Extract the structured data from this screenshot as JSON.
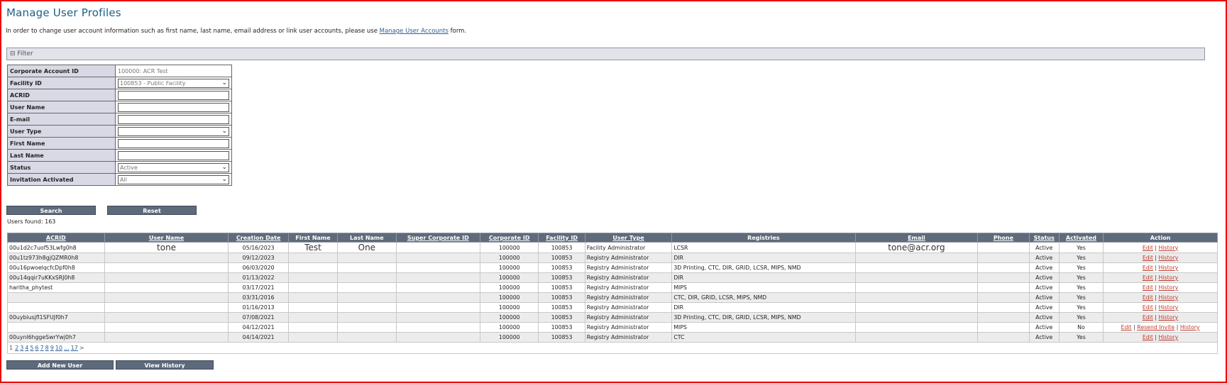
{
  "page_title": "Manage User Profiles",
  "intro": {
    "before": "In order to change user account information such as first name, last name, email address or link user accounts, please use ",
    "link": "Manage User Accounts",
    "after": " form."
  },
  "filter": {
    "toggle": "⊟",
    "label": "Filter",
    "fields": [
      {
        "label": "Corporate Account ID",
        "kind": "static",
        "value": "100000: ACR Test"
      },
      {
        "label": "Facility ID",
        "kind": "select",
        "value": "100853 - Public Facility"
      },
      {
        "label": "ACRID",
        "kind": "input",
        "value": ""
      },
      {
        "label": "User Name",
        "kind": "input",
        "value": ""
      },
      {
        "label": "E-mail",
        "kind": "input",
        "value": ""
      },
      {
        "label": "User Type",
        "kind": "select",
        "value": ""
      },
      {
        "label": "First Name",
        "kind": "input",
        "value": ""
      },
      {
        "label": "Last Name",
        "kind": "input",
        "value": ""
      },
      {
        "label": "Status",
        "kind": "select",
        "value": "Active"
      },
      {
        "label": "Invitation Activated",
        "kind": "select",
        "value": "All"
      }
    ]
  },
  "buttons": {
    "search": "Search",
    "reset": "Reset",
    "add_user": "Add New User",
    "view_history": "View History"
  },
  "users_found": "Users found: 163",
  "table": {
    "headers": [
      {
        "label": "ACRID",
        "sortable": true
      },
      {
        "label": "User Name",
        "sortable": true
      },
      {
        "label": "Creation Date",
        "sortable": true
      },
      {
        "label": "First Name",
        "sortable": false
      },
      {
        "label": "Last Name",
        "sortable": false
      },
      {
        "label": "Super Corporate ID",
        "sortable": true
      },
      {
        "label": "Corporate ID",
        "sortable": true
      },
      {
        "label": "Facility ID",
        "sortable": true
      },
      {
        "label": "User Type",
        "sortable": true
      },
      {
        "label": "Registries",
        "sortable": false
      },
      {
        "label": "Email",
        "sortable": true
      },
      {
        "label": "Phone",
        "sortable": true
      },
      {
        "label": "Status",
        "sortable": true
      },
      {
        "label": "Activated",
        "sortable": true
      },
      {
        "label": "Action",
        "sortable": false
      }
    ],
    "rows": [
      {
        "acrid": "00u1d2c7uof53Lwfg0h8",
        "username": "tone",
        "created": "05/16/2023",
        "first": "Test",
        "last": "One",
        "super": "",
        "corp": "100000",
        "facility": "100853",
        "type": "Facility Administrator",
        "registries": "LCSR",
        "email": "tone@acr.org",
        "phone": "",
        "status": "Active",
        "activated": "Yes",
        "actions": [
          "Edit",
          "History"
        ]
      },
      {
        "acrid": "00u1tz973h8gjQZMR0h8",
        "username": "",
        "created": "09/12/2023",
        "first": "",
        "last": "",
        "super": "",
        "corp": "100000",
        "facility": "100853",
        "type": "Registry Administrator",
        "registries": "DIR",
        "email": "",
        "phone": "",
        "status": "Active",
        "activated": "Yes",
        "actions": [
          "Edit",
          "History"
        ]
      },
      {
        "acrid": "00u16pwoelqcfcDpf0h8",
        "username": "",
        "created": "06/03/2020",
        "first": "",
        "last": "",
        "super": "",
        "corp": "100000",
        "facility": "100853",
        "type": "Registry Administrator",
        "registries": "3D Printing, CTC, DIR, GRID, LCSR, MIPS, NMD",
        "email": "",
        "phone": "",
        "status": "Active",
        "activated": "Yes",
        "actions": [
          "Edit",
          "History"
        ]
      },
      {
        "acrid": "00u14qqir7uKKxSRJ0h8",
        "username": "",
        "created": "01/13/2022",
        "first": "",
        "last": "",
        "super": "",
        "corp": "100000",
        "facility": "100853",
        "type": "Registry Administrator",
        "registries": "DIR",
        "email": "",
        "phone": "",
        "status": "Active",
        "activated": "Yes",
        "actions": [
          "Edit",
          "History"
        ]
      },
      {
        "acrid": "haritha_phytest",
        "username": "",
        "created": "03/17/2021",
        "first": "",
        "last": "",
        "super": "",
        "corp": "100000",
        "facility": "100853",
        "type": "Registry Administrator",
        "registries": "MIPS",
        "email": "",
        "phone": "",
        "status": "Active",
        "activated": "Yes",
        "actions": [
          "Edit",
          "History"
        ]
      },
      {
        "acrid": "",
        "username": "",
        "created": "03/31/2016",
        "first": "",
        "last": "",
        "super": "",
        "corp": "100000",
        "facility": "100853",
        "type": "Registry Administrator",
        "registries": "CTC, DIR, GRID, LCSR, MIPS, NMD",
        "email": "",
        "phone": "",
        "status": "Active",
        "activated": "Yes",
        "actions": [
          "Edit",
          "History"
        ]
      },
      {
        "acrid": "",
        "username": "",
        "created": "01/16/2013",
        "first": "",
        "last": "",
        "super": "",
        "corp": "100000",
        "facility": "100853",
        "type": "Registry Administrator",
        "registries": "DIR",
        "email": "",
        "phone": "",
        "status": "Active",
        "activated": "Yes",
        "actions": [
          "Edit",
          "History"
        ]
      },
      {
        "acrid": "00uybiusjfl1SFUJf0h7",
        "username": "",
        "created": "07/08/2021",
        "first": "",
        "last": "",
        "super": "",
        "corp": "100000",
        "facility": "100853",
        "type": "Registry Administrator",
        "registries": "3D Printing, CTC, DIR, GRID, LCSR, MIPS, NMD",
        "email": "",
        "phone": "",
        "status": "Active",
        "activated": "Yes",
        "actions": [
          "Edit",
          "History"
        ]
      },
      {
        "acrid": "",
        "username": "",
        "created": "04/12/2021",
        "first": "",
        "last": "",
        "super": "",
        "corp": "100000",
        "facility": "100853",
        "type": "Registry Administrator",
        "registries": "MIPS",
        "email": "",
        "phone": "",
        "status": "Active",
        "activated": "No",
        "actions": [
          "Edit",
          "Resend Invite",
          "History"
        ]
      },
      {
        "acrid": "00uynl6hggeSwrYwj0h7",
        "username": "",
        "created": "04/14/2021",
        "first": "",
        "last": "",
        "super": "",
        "corp": "100000",
        "facility": "100853",
        "type": "Registry Administrator",
        "registries": "CTC",
        "email": "",
        "phone": "",
        "status": "Active",
        "activated": "Yes",
        "actions": [
          "Edit",
          "History"
        ]
      }
    ]
  },
  "pager": {
    "current": "1",
    "pages": [
      "2",
      "3",
      "4",
      "5",
      "6",
      "7",
      "8",
      "9",
      "10",
      "...",
      "17"
    ],
    "next": ">"
  }
}
